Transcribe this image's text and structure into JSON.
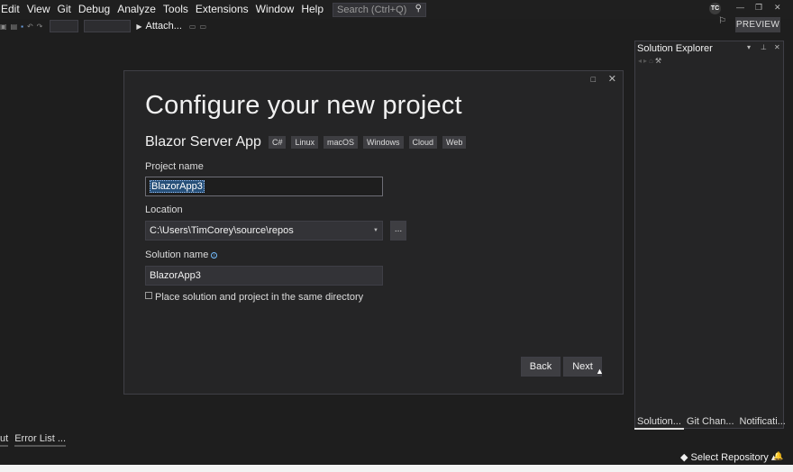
{
  "menu": [
    "Edit",
    "View",
    "Git",
    "Debug",
    "Analyze",
    "Tools",
    "Extensions",
    "Window",
    "Help"
  ],
  "search": {
    "placeholder": "Search (Ctrl+Q)"
  },
  "account_initials": "TC",
  "preview_label": "PREVIEW",
  "toolbar": {
    "attach_label": "Attach..."
  },
  "dialog": {
    "title": "Configure your new project",
    "template_name": "Blazor Server App",
    "tags": [
      "C#",
      "Linux",
      "macOS",
      "Windows",
      "Cloud",
      "Web"
    ],
    "project_name_label": "Project name",
    "project_name_value": "BlazorApp3",
    "location_label": "Location",
    "location_value": "C:\\Users\\TimCorey\\source\\repos",
    "browse_label": "...",
    "solution_name_label": "Solution name",
    "solution_name_value": "BlazorApp3",
    "same_dir_label": "Place solution and project in the same directory",
    "back_label": "Back",
    "next_label": "Next"
  },
  "solution_explorer": {
    "title": "Solution Explorer",
    "tabs": [
      "Solution...",
      "Git Chan...",
      "Notificati..."
    ]
  },
  "bottom_tabs": [
    "ut",
    "Error List ..."
  ],
  "status": {
    "repo_label": "Select Repository"
  }
}
